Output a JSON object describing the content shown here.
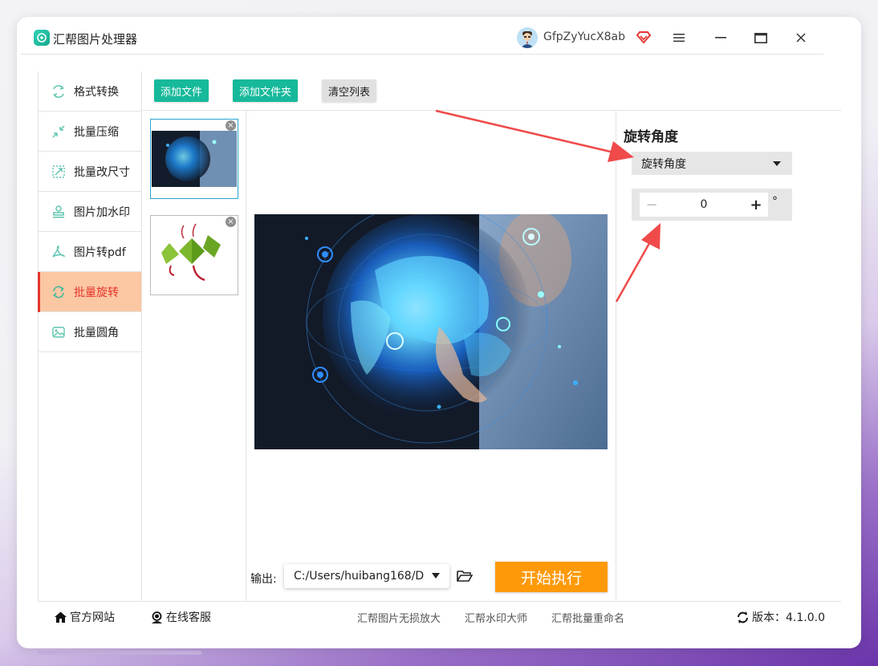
{
  "app": {
    "title": "汇帮图片处理器",
    "username": "GfpZyYucX8ab"
  },
  "sidebar": {
    "items": [
      {
        "label": "格式转换"
      },
      {
        "label": "批量压缩"
      },
      {
        "label": "批量改尺寸"
      },
      {
        "label": "图片加水印"
      },
      {
        "label": "图片转pdf"
      },
      {
        "label": "批量旋转",
        "active": true
      },
      {
        "label": "批量圆角"
      }
    ]
  },
  "toolbar": {
    "add_file": "添加文件",
    "add_folder": "添加文件夹",
    "clear_list": "清空列表"
  },
  "main": {
    "output_label": "输出:",
    "output_path": "C:/Users/huibang168/D",
    "start_button": "开始执行"
  },
  "settings": {
    "title": "旋转角度",
    "select_value": "旋转角度",
    "angle_value": "0",
    "unit": "°"
  },
  "footer": {
    "website": "官方网站",
    "service": "在线客服",
    "link1": "汇帮图片无损放大",
    "link2": "汇帮水印大师",
    "link3": "汇帮批量重命名",
    "version": "版本：4.1.0.0"
  },
  "colors": {
    "accent_green": "#17b99b",
    "active_bg": "#fcc7a3",
    "active_text": "#e5352b",
    "start_orange": "#fe9a09",
    "arrow_red": "#f04a4a"
  }
}
